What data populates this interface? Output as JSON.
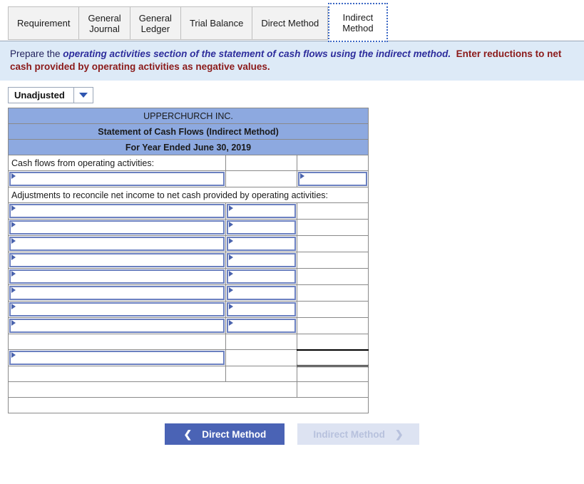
{
  "tabs": [
    {
      "label": "Requirement",
      "active": false
    },
    {
      "label": "General\nJournal",
      "active": false
    },
    {
      "label": "General\nLedger",
      "active": false
    },
    {
      "label": "Trial Balance",
      "active": false
    },
    {
      "label": "Direct Method",
      "active": false
    },
    {
      "label": "Indirect\nMethod",
      "active": true
    }
  ],
  "tab_labels": {
    "requirement": "Requirement",
    "general_journal_line1": "General",
    "general_journal_line2": "Journal",
    "general_ledger_line1": "General",
    "general_ledger_line2": "Ledger",
    "trial_balance": "Trial Balance",
    "direct_method": "Direct Method",
    "indirect_method_line1": "Indirect",
    "indirect_method_line2": "Method"
  },
  "banner": {
    "lead": "Prepare the ",
    "emphasis": "operating activities section of the statement of cash flows using the indirect method.",
    "warning": "Enter reductions to net cash provided by operating activities as negative values."
  },
  "toolbar": {
    "adjustment_select_value": "Unadjusted",
    "caret_icon": "chevron-down-icon"
  },
  "statement": {
    "company": "UPPERCHURCH INC.",
    "title": "Statement of Cash Flows (Indirect Method)",
    "period": "For Year Ended June 30, 2019",
    "section_operating": "Cash flows from operating activities:",
    "section_adjustments": "Adjustments to reconcile net income to net cash provided by operating activities:",
    "empty_value": ""
  },
  "nav": {
    "prev_label": "Direct Method",
    "prev_icon": "chevron-left-icon",
    "next_label": "Indirect Method",
    "next_icon": "chevron-right-icon"
  },
  "colors": {
    "header_blue": "#8da9e0",
    "banner_blue": "#ddeaf7",
    "input_border": "#6b80c0",
    "primary_button": "#4a63b5",
    "disabled_button": "#dde3f2",
    "emphasis_text": "#2d2d9c",
    "warning_text": "#8b1a1a"
  }
}
